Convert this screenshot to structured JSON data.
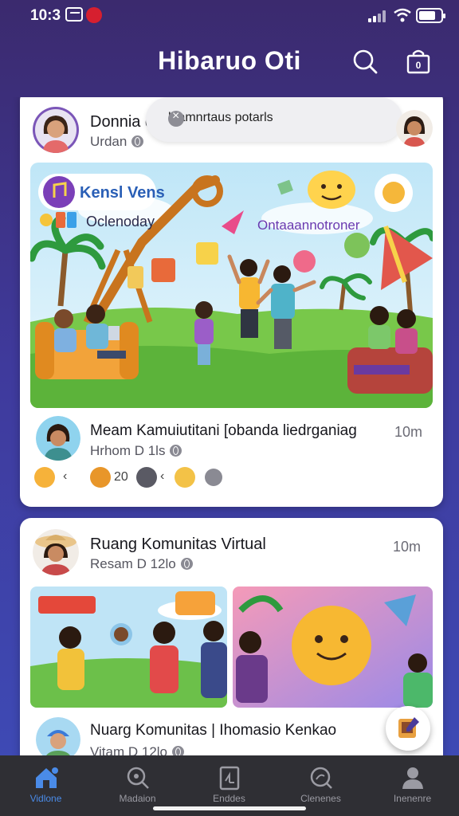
{
  "status": {
    "time": "10:3",
    "icons": [
      "gallery-icon",
      "record-icon",
      "signal-icon",
      "wifi-icon",
      "battery-icon"
    ]
  },
  "header": {
    "title": "Hibaruo Oti",
    "actions": [
      "search-icon",
      "shopping-bag-icon"
    ],
    "bag_badge": "0"
  },
  "posts": [
    {
      "author": "Donnia dral",
      "meta": "Urdan",
      "search_placeholder": "blamnrtaus potarls",
      "banner_title": "Kensl Vens",
      "banner_sub": "Oclenoday",
      "banner_caption": "Ontaaannotroner",
      "commenter": "Meam Kamuiutitani [obanda liedrganiag",
      "comment_meta": "Hrhom D 1ls",
      "comment_time": "10m",
      "reaction_count": "20"
    },
    {
      "author": "Ruang Komunitas Virtual",
      "meta": "Resam D 12lo",
      "time": "10m",
      "image_left_tag": "",
      "image_left_bubble": "",
      "image_right_text": "",
      "commenter": "Nuarg Komunitas | Ihomasio Kenkao",
      "comment_meta": "Vitam D 12lo"
    }
  ],
  "nav": {
    "items": [
      {
        "label": "Vidlone",
        "icon": "home-icon",
        "active": true
      },
      {
        "label": "Madaion",
        "icon": "search-icon",
        "active": false
      },
      {
        "label": "Enddes",
        "icon": "document-icon",
        "active": false
      },
      {
        "label": "Clenenes",
        "icon": "explore-icon",
        "active": false
      },
      {
        "label": "Inenenre",
        "icon": "profile-icon",
        "active": false
      }
    ]
  },
  "colors": {
    "background_top": "#3b2a6e",
    "background_bottom": "#3e4cb8",
    "nav_background": "#2f2f34",
    "nav_active": "#4a8be8",
    "card": "#ffffff"
  }
}
